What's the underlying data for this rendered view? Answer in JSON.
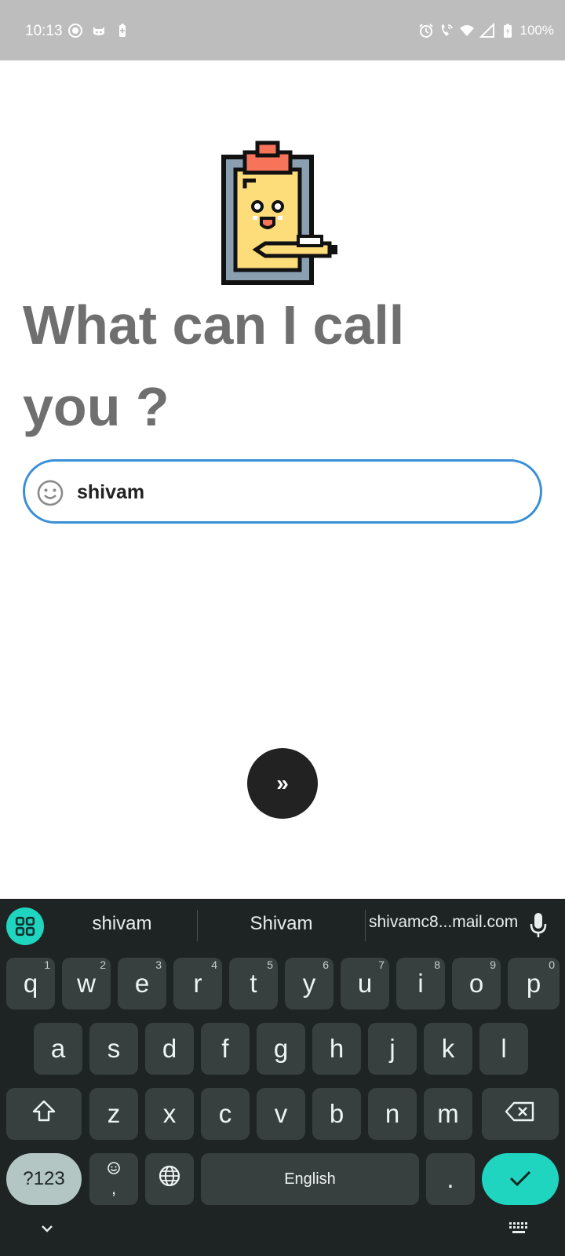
{
  "status_bar": {
    "time": "10:13",
    "battery_text": "100%",
    "left_icons": [
      "screen-record-icon",
      "cat-icon",
      "battery-saver-icon"
    ],
    "right_icons": [
      "alarm-icon",
      "wifi-calling-icon",
      "wifi-icon",
      "signal-icon",
      "battery-icon"
    ]
  },
  "main": {
    "headline": "What can I call you ?",
    "name_input": {
      "value": "shivam",
      "icon": "smiley-icon"
    },
    "next_button": {
      "label": "»",
      "icon": "double-chevron-right-icon"
    }
  },
  "keyboard": {
    "suggestions": [
      "shivam",
      "Shivam",
      "shivamc8...mail.com"
    ],
    "row1": [
      {
        "key": "q",
        "hint": "1"
      },
      {
        "key": "w",
        "hint": "2"
      },
      {
        "key": "e",
        "hint": "3"
      },
      {
        "key": "r",
        "hint": "4"
      },
      {
        "key": "t",
        "hint": "5"
      },
      {
        "key": "y",
        "hint": "6"
      },
      {
        "key": "u",
        "hint": "7"
      },
      {
        "key": "i",
        "hint": "8"
      },
      {
        "key": "o",
        "hint": "9"
      },
      {
        "key": "p",
        "hint": "0"
      }
    ],
    "row2": [
      "a",
      "s",
      "d",
      "f",
      "g",
      "h",
      "j",
      "k",
      "l"
    ],
    "row3": [
      "z",
      "x",
      "c",
      "v",
      "b",
      "n",
      "m"
    ],
    "symbols_label": "?123",
    "emoji_comma_label": ",",
    "space_label": "English",
    "period_label": ".",
    "colors": {
      "enter": "#1fd5c0",
      "symbols": "#b3c6c3",
      "background": "#1e2423",
      "key": "#383f3f"
    }
  }
}
